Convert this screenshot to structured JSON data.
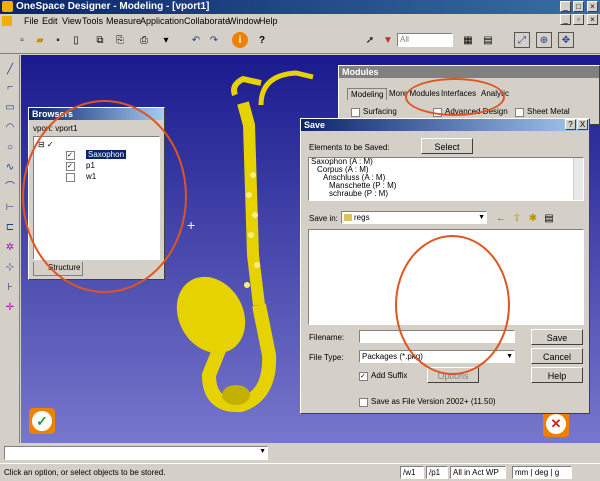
{
  "window": {
    "title": "OneSpace Designer - Modeling - [vport1]"
  },
  "menu": [
    "File",
    "Edit",
    "View",
    "Tools",
    "Measure",
    "Application",
    "Collaborate",
    "Window",
    "Help"
  ],
  "toolbar": {
    "filter_value": "All"
  },
  "browser": {
    "title": "Browsers",
    "vport": "vport: vport1",
    "items": [
      "Saxophon",
      "p1",
      "w1"
    ],
    "tab": "Structure"
  },
  "modules": {
    "title": "Modules",
    "tabs": [
      "Modeling",
      "More Modules",
      "Interfaces",
      "Analytic"
    ],
    "options": [
      "Surfacing",
      "Advanced Design",
      "Sheet Metal"
    ]
  },
  "save_dialog": {
    "title": "Save",
    "help_glyph": "?",
    "close_glyph": "X",
    "elements_label": "Elements to be Saved:",
    "select_button": "Select",
    "elements": [
      "Saxophon  (A : M)",
      "Corpus  (A : M)",
      "Anschluss  (A : M)",
      "Manschette  (P : M)",
      "schraube  (P : M)"
    ],
    "save_in_label": "Save in:",
    "save_in_value": "regs",
    "filename_label": "Filename:",
    "filename_value": "",
    "filetype_label": "File Type:",
    "filetype_value": "Packages (*.pkg)",
    "add_suffix": "Add Suffix",
    "options_button": "Options",
    "save_as_version": "Save as File Version 2002+ (11.50)",
    "buttons": {
      "save": "Save",
      "cancel": "Cancel",
      "help": "Help"
    }
  },
  "status": {
    "message": "Click an option, or select objects to be stored.",
    "fields": [
      "/w1",
      "/p1",
      "All in Act WP",
      "mm | deg | g"
    ]
  },
  "colors": {
    "accent": "#0a246a",
    "annotation": "#e0551f",
    "instrument": "#e6d200"
  }
}
